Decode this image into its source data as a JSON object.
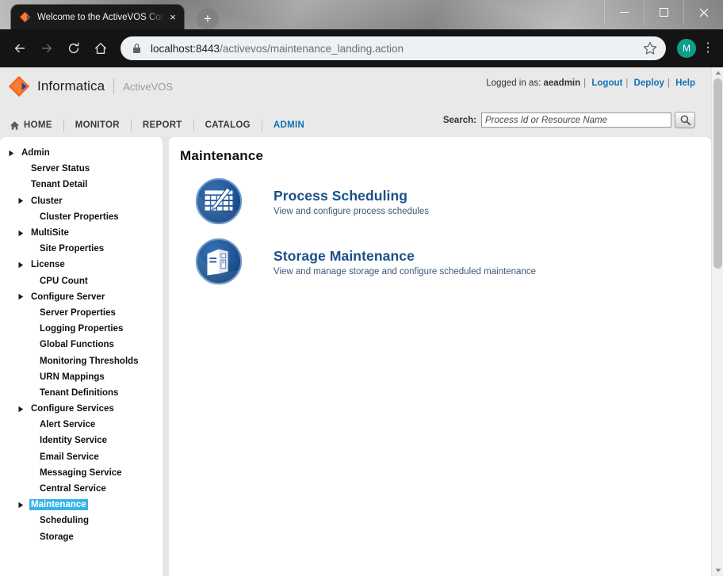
{
  "browser": {
    "tab": {
      "title": "Welcome to the ActiveVOS Cons",
      "favicon_name": "informatica-favicon",
      "close_label": "×"
    },
    "new_tab_label": "+",
    "window_controls": {
      "minimize": "–",
      "maximize": "□",
      "close": "×"
    },
    "nav": {
      "back": "←",
      "forward": "→",
      "reload": "⟳",
      "home": "⌂"
    },
    "omnibox": {
      "host": "localhost:8443",
      "path": "/activevos/maintenance_landing.action",
      "full_url": "localhost:8443/activevos/maintenance_landing.action",
      "lock_icon": "padlock-icon",
      "star_icon": "bookmark-star-icon"
    },
    "profile": {
      "initial": "M",
      "color": "#0e9d8b"
    },
    "menu_label": "⋮"
  },
  "app_header": {
    "brand_name": "Informatica",
    "product_name": "ActiveVOS",
    "account": {
      "logged_in_prefix": "Logged in as:",
      "username": "aeadmin",
      "separator": "|",
      "logout": "Logout",
      "deploy": "Deploy",
      "help": "Help"
    },
    "search": {
      "label": "Search:",
      "placeholder": "Process Id or Resource Name",
      "value": "",
      "button_icon": "magnifier-icon"
    },
    "nav_items": [
      {
        "label": "HOME",
        "active": false,
        "icon": "home-icon"
      },
      {
        "label": "MONITOR",
        "active": false
      },
      {
        "label": "REPORT",
        "active": false
      },
      {
        "label": "CATALOG",
        "active": false
      },
      {
        "label": "ADMIN",
        "active": true
      }
    ],
    "accent_color": "#1272b5"
  },
  "sidebar": {
    "items": [
      {
        "label": "Admin",
        "level": 0,
        "expandable": true,
        "selected": false
      },
      {
        "label": "Server Status",
        "level": 1,
        "expandable": false,
        "selected": false
      },
      {
        "label": "Tenant Detail",
        "level": 1,
        "expandable": false,
        "selected": false
      },
      {
        "label": "Cluster",
        "level": 1,
        "expandable": true,
        "selected": false
      },
      {
        "label": "Cluster Properties",
        "level": 2,
        "expandable": false,
        "selected": false
      },
      {
        "label": "MultiSite",
        "level": 1,
        "expandable": true,
        "selected": false
      },
      {
        "label": "Site Properties",
        "level": 2,
        "expandable": false,
        "selected": false
      },
      {
        "label": "License",
        "level": 1,
        "expandable": true,
        "selected": false
      },
      {
        "label": "CPU Count",
        "level": 2,
        "expandable": false,
        "selected": false
      },
      {
        "label": "Configure Server",
        "level": 1,
        "expandable": true,
        "selected": false
      },
      {
        "label": "Server Properties",
        "level": 2,
        "expandable": false,
        "selected": false
      },
      {
        "label": "Logging Properties",
        "level": 2,
        "expandable": false,
        "selected": false
      },
      {
        "label": "Global Functions",
        "level": 2,
        "expandable": false,
        "selected": false
      },
      {
        "label": "Monitoring Thresholds",
        "level": 2,
        "expandable": false,
        "selected": false
      },
      {
        "label": "URN Mappings",
        "level": 2,
        "expandable": false,
        "selected": false
      },
      {
        "label": "Tenant Definitions",
        "level": 2,
        "expandable": false,
        "selected": false
      },
      {
        "label": "Configure Services",
        "level": 1,
        "expandable": true,
        "selected": false
      },
      {
        "label": "Alert Service",
        "level": 2,
        "expandable": false,
        "selected": false
      },
      {
        "label": "Identity Service",
        "level": 2,
        "expandable": false,
        "selected": false
      },
      {
        "label": "Email Service",
        "level": 2,
        "expandable": false,
        "selected": false
      },
      {
        "label": "Messaging Service",
        "level": 2,
        "expandable": false,
        "selected": false
      },
      {
        "label": "Central Service",
        "level": 2,
        "expandable": false,
        "selected": false
      },
      {
        "label": "Maintenance",
        "level": 1,
        "expandable": true,
        "selected": true
      },
      {
        "label": "Scheduling",
        "level": 2,
        "expandable": false,
        "selected": false
      },
      {
        "label": "Storage",
        "level": 2,
        "expandable": false,
        "selected": false
      }
    ],
    "selection_color": "#36b4ea"
  },
  "content": {
    "title": "Maintenance",
    "items": [
      {
        "title": "Process Scheduling",
        "description": "View and configure process schedules",
        "icon": "calendar-pencil-icon"
      },
      {
        "title": "Storage Maintenance",
        "description": "View and manage storage and configure scheduled maintenance",
        "icon": "server-tower-icon"
      }
    ],
    "link_color": "#1a4f8a"
  },
  "scrollbar": {
    "up_arrow": "▲",
    "down_arrow": "▼"
  }
}
